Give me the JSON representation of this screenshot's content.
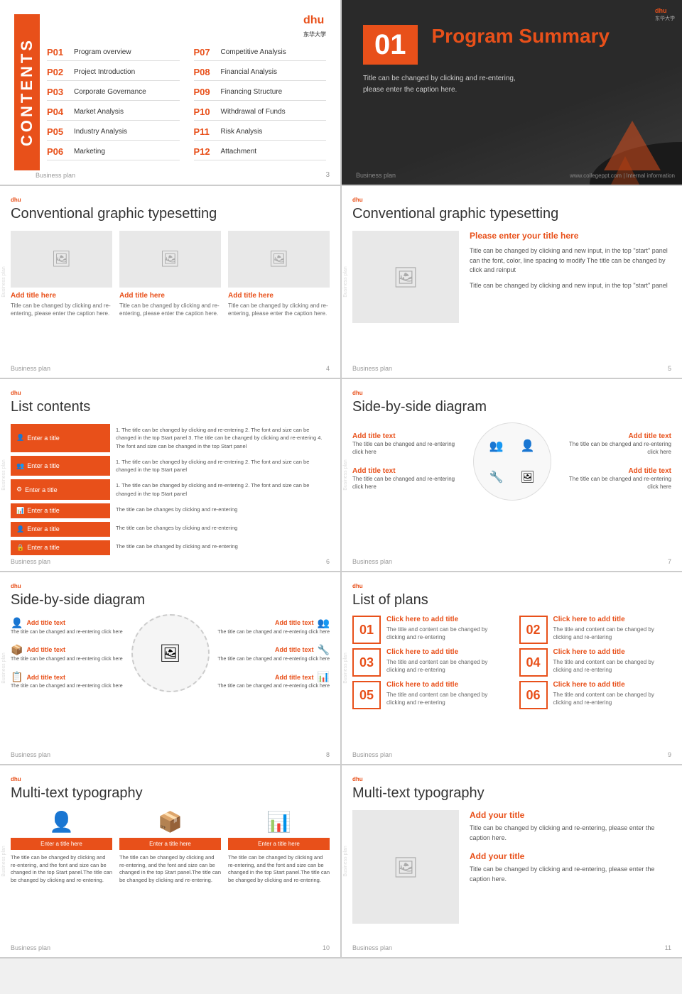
{
  "brand": {
    "name": "dhu",
    "tagline": "东华大学",
    "logo_text": "dhu 东华大学"
  },
  "panel1": {
    "sidebar_text": "CONTENTS",
    "toc_items": [
      {
        "num": "P01",
        "label": "Program overview"
      },
      {
        "num": "P07",
        "label": "Competitive Analysis"
      },
      {
        "num": "P02",
        "label": "Project Introduction"
      },
      {
        "num": "P08",
        "label": "Financial Analysis"
      },
      {
        "num": "P03",
        "label": "Corporate Governance"
      },
      {
        "num": "P09",
        "label": "Financing Structure"
      },
      {
        "num": "P04",
        "label": "Market Analysis"
      },
      {
        "num": "P10",
        "label": "Withdrawal of Funds"
      },
      {
        "num": "P05",
        "label": "Industry Analysis"
      },
      {
        "num": "P11",
        "label": "Risk Analysis"
      },
      {
        "num": "P06",
        "label": "Marketing"
      },
      {
        "num": "P12",
        "label": "Attachment"
      }
    ],
    "footer": "Business plan",
    "page_num": "3"
  },
  "panel2": {
    "page_num": "01",
    "title": "Program Summary",
    "desc_line1": "Title can be changed by clicking and re-entering,",
    "desc_line2": "please enter the caption here.",
    "footer_left": "Business plan",
    "footer_right": "www.collegeppt.com | Internal information"
  },
  "panel3": {
    "title": "Conventional graphic typesetting",
    "items": [
      {
        "title": "Add title here",
        "desc": "Title can be changed by clicking and re-entering, please enter the caption here."
      },
      {
        "title": "Add title here",
        "desc": "Title can be changed by clicking and re-entering, please enter the caption here."
      },
      {
        "title": "Add title here",
        "desc": "Title can be changed by clicking and re-entering, please enter the caption here."
      }
    ],
    "page_num": "4"
  },
  "panel4": {
    "title": "Conventional graphic typesetting",
    "item_title": "Please enter your title here",
    "desc1": "Title can be changed by clicking and new input, in the top \"start\" panel can the font, color, line spacing to modify The title can be changed by click and reinput",
    "desc2": "Title can be changed by clicking and new input, in the top \"start\" panel",
    "page_num": "5"
  },
  "panel5": {
    "title": "List contents",
    "items": [
      {
        "btn": "Enter a title",
        "icon": "👤",
        "texts": [
          "1. The title can be changed by clicking and re-entering",
          "2. The font and size can be changed in the top Start panel",
          "3. The title can be changed by clicking and re-entering",
          "4. The font and size can be changed in the top Start panel"
        ]
      },
      {
        "btn": "Enter a title",
        "icon": "👥",
        "texts": [
          "1. The title can be changed by clicking and re-entering",
          "2. The font and size can be changed in the top Start panel"
        ]
      },
      {
        "btn": "Enter a title",
        "icon": "⚙️",
        "texts": [
          "1. The title can be changed by clicking and re-entering",
          "2. The font and size can be changed in the top Start panel"
        ]
      },
      {
        "btn": "Enter a title",
        "icon": "📊",
        "texts": [
          "The title can be changes by clicking and re-entering"
        ]
      },
      {
        "btn": "Enter a title",
        "icon": "👤",
        "texts": [
          "The title can be changes by clicking and re-entering"
        ]
      },
      {
        "btn": "Enter a title",
        "icon": "🔒",
        "texts": [
          "The title can be changed by clicking and re-entering"
        ]
      }
    ],
    "page_num": "6"
  },
  "panel6": {
    "title": "Side-by-side diagram",
    "items": [
      {
        "title": "Add title text",
        "desc": "The title can be changed and re-entering click here",
        "pos": "top-left"
      },
      {
        "title": "Add title text",
        "desc": "The title can be changed and re-entering click here",
        "pos": "top-right"
      },
      {
        "title": "Add title text",
        "desc": "The title can be changed and re-entering click here",
        "pos": "bot-left"
      },
      {
        "title": "Add title text",
        "desc": "The title can be changed and re-entering click here",
        "pos": "bot-right"
      }
    ],
    "page_num": "7"
  },
  "panel7": {
    "title": "Side-by-side diagram",
    "items": [
      {
        "title": "Add title text",
        "desc": "The title can be changed and re-entering click here"
      },
      {
        "title": "Add title text",
        "desc": "The title can be changed and re-entering click here"
      },
      {
        "title": "Add title text",
        "desc": "The title can be changed and re-entering click here"
      },
      {
        "title": "Add title text",
        "desc": "The title can be changed and re-entering click here"
      },
      {
        "title": "Add title text",
        "desc": "The title can be changed and re-entering click here"
      },
      {
        "title": "Add title text",
        "desc": "The title can be changed and re-entering click here"
      }
    ],
    "page_num": "8"
  },
  "panel8": {
    "title": "List of plans",
    "items": [
      {
        "num": "01",
        "title": "Click here to add title",
        "desc": "The title and content can be changed by clicking and re-entering"
      },
      {
        "num": "02",
        "title": "Click here to add title",
        "desc": "The title and content can be changed by clicking and re-entering"
      },
      {
        "num": "03",
        "title": "Click here to add title",
        "desc": "The title and content can be changed by clicking and re-entering"
      },
      {
        "num": "04",
        "title": "Click here to add title",
        "desc": "The title and content can be changed by clicking and re-entering"
      },
      {
        "num": "05",
        "title": "Click here to add title",
        "desc": "The title and content can be changed by clicking and re-entering"
      },
      {
        "num": "06",
        "title": "Click here to add title",
        "desc": "The title and content can be changed by clicking and re-entering"
      }
    ],
    "page_num": "9"
  },
  "panel9": {
    "title": "Multi-text typography",
    "items": [
      {
        "icon": "👤",
        "btn": "Enter a title here",
        "desc": "The title can be changed by clicking and re-entering, and the font and size can be changed in the top Start panel.The title can be changed by clicking and re-entering."
      },
      {
        "icon": "📦",
        "btn": "Enter a title here",
        "desc": "The title can be changed by clicking and re-entering, and the font and size can be changed in the top Start panel.The title can be changed by clicking and re-entering."
      },
      {
        "icon": "📊",
        "btn": "Enter a title here",
        "desc": "The title can be changed by clicking and re-entering, and the font and size can be changed in the top Start panel.The title can be changed by clicking and re-entering."
      }
    ],
    "page_num": "10"
  },
  "panel10": {
    "title": "Multi-text typography",
    "title1": "Add your title",
    "desc1": "Title can be changed by clicking and re-entering, please enter the caption here.",
    "title2": "Add your title",
    "desc2": "Title can be changed by clicking and re-entering, please enter the caption here.",
    "page_num": "11"
  },
  "icons": {
    "image": "🖼",
    "user": "👤",
    "users": "👥",
    "gear": "⚙",
    "chart": "📊",
    "lock": "🔒",
    "box": "📦"
  }
}
